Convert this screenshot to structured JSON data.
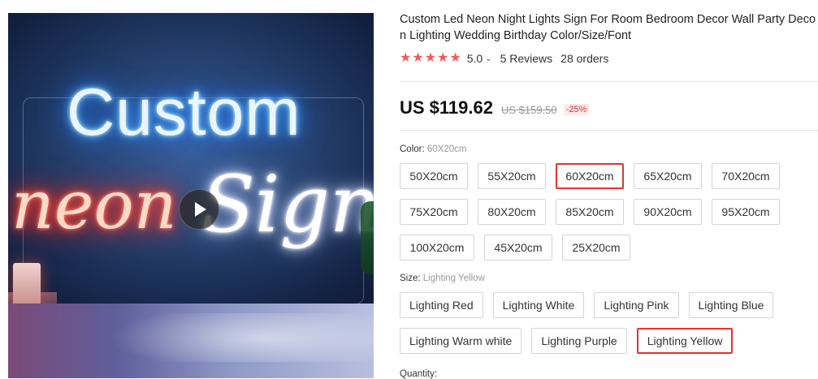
{
  "media": {
    "image_text": {
      "line1": "Custom",
      "line2a": "neon",
      "line2b": "Signs"
    }
  },
  "product": {
    "title_line1": "Custom Led Neon Night Lights Sign For Room Bedroom Decor Wall Party Deco",
    "title_line2": "n Lighting Wedding Birthday Color/Size/Font",
    "rating_value": "5.0",
    "rating_chevron": "⌄",
    "reviews": "5 Reviews",
    "orders": "28 orders",
    "stars_filled": 5,
    "star_glyph": "★",
    "price": "US $119.62",
    "original_price": "US $159.50",
    "discount": "-25%",
    "quantity_label": "Quantity:"
  },
  "color_property": {
    "label": "Color: ",
    "selected_value": "60X20cm",
    "options": [
      "50X20cm",
      "55X20cm",
      "60X20cm",
      "65X20cm",
      "70X20cm",
      "75X20cm",
      "80X20cm",
      "85X20cm",
      "90X20cm",
      "95X20cm",
      "100X20cm",
      "45X20cm",
      "25X20cm"
    ]
  },
  "size_property": {
    "label": "Size: ",
    "selected_value": "Lighting Yellow",
    "options": [
      "Lighting Red",
      "Lighting White",
      "Lighting Pink",
      "Lighting Blue",
      "Lighting Warm white",
      "Lighting Purple",
      "Lighting Yellow"
    ]
  },
  "colors": {
    "accent": "#e3342f",
    "star": "#f55a5a"
  },
  "icons": {
    "play": "play-icon"
  }
}
